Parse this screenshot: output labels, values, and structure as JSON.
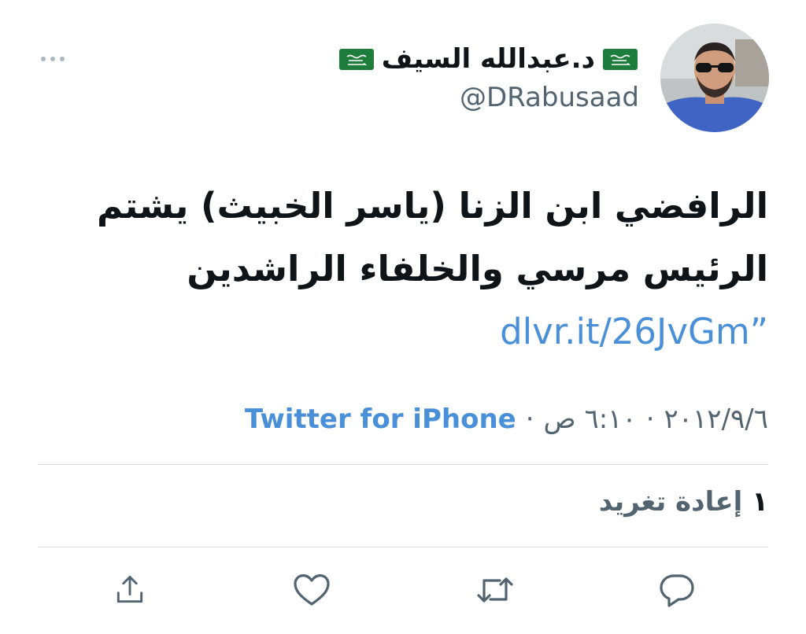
{
  "user": {
    "display_name": "د.عبدالله السيف",
    "handle": "@DRabusaad",
    "avatar_icon": "profile-photo",
    "flag_icon": "saudi-flag"
  },
  "tweet": {
    "text": "الرافضي ابن الزنا  (ياسر الخبيث) يشتم الرئيس مرسي والخلفاء الراشدين",
    "link": "dlvr.it/26JvGm",
    "closing_quote": "”"
  },
  "meta": {
    "date": "٢٠١٢/٩/٦",
    "time": "٦:١٠ ص",
    "separator": "·",
    "source": "Twitter for iPhone"
  },
  "stats": {
    "retweet_count": "١",
    "retweet_label": "إعادة تغريد"
  },
  "actions": {
    "reply_icon": "reply-icon",
    "retweet_icon": "retweet-icon",
    "like_icon": "heart-icon",
    "share_icon": "share-icon"
  },
  "colors": {
    "link": "#4a90d9",
    "secondary": "#536471",
    "icon": "#536471",
    "divider": "#d9d9d9"
  }
}
